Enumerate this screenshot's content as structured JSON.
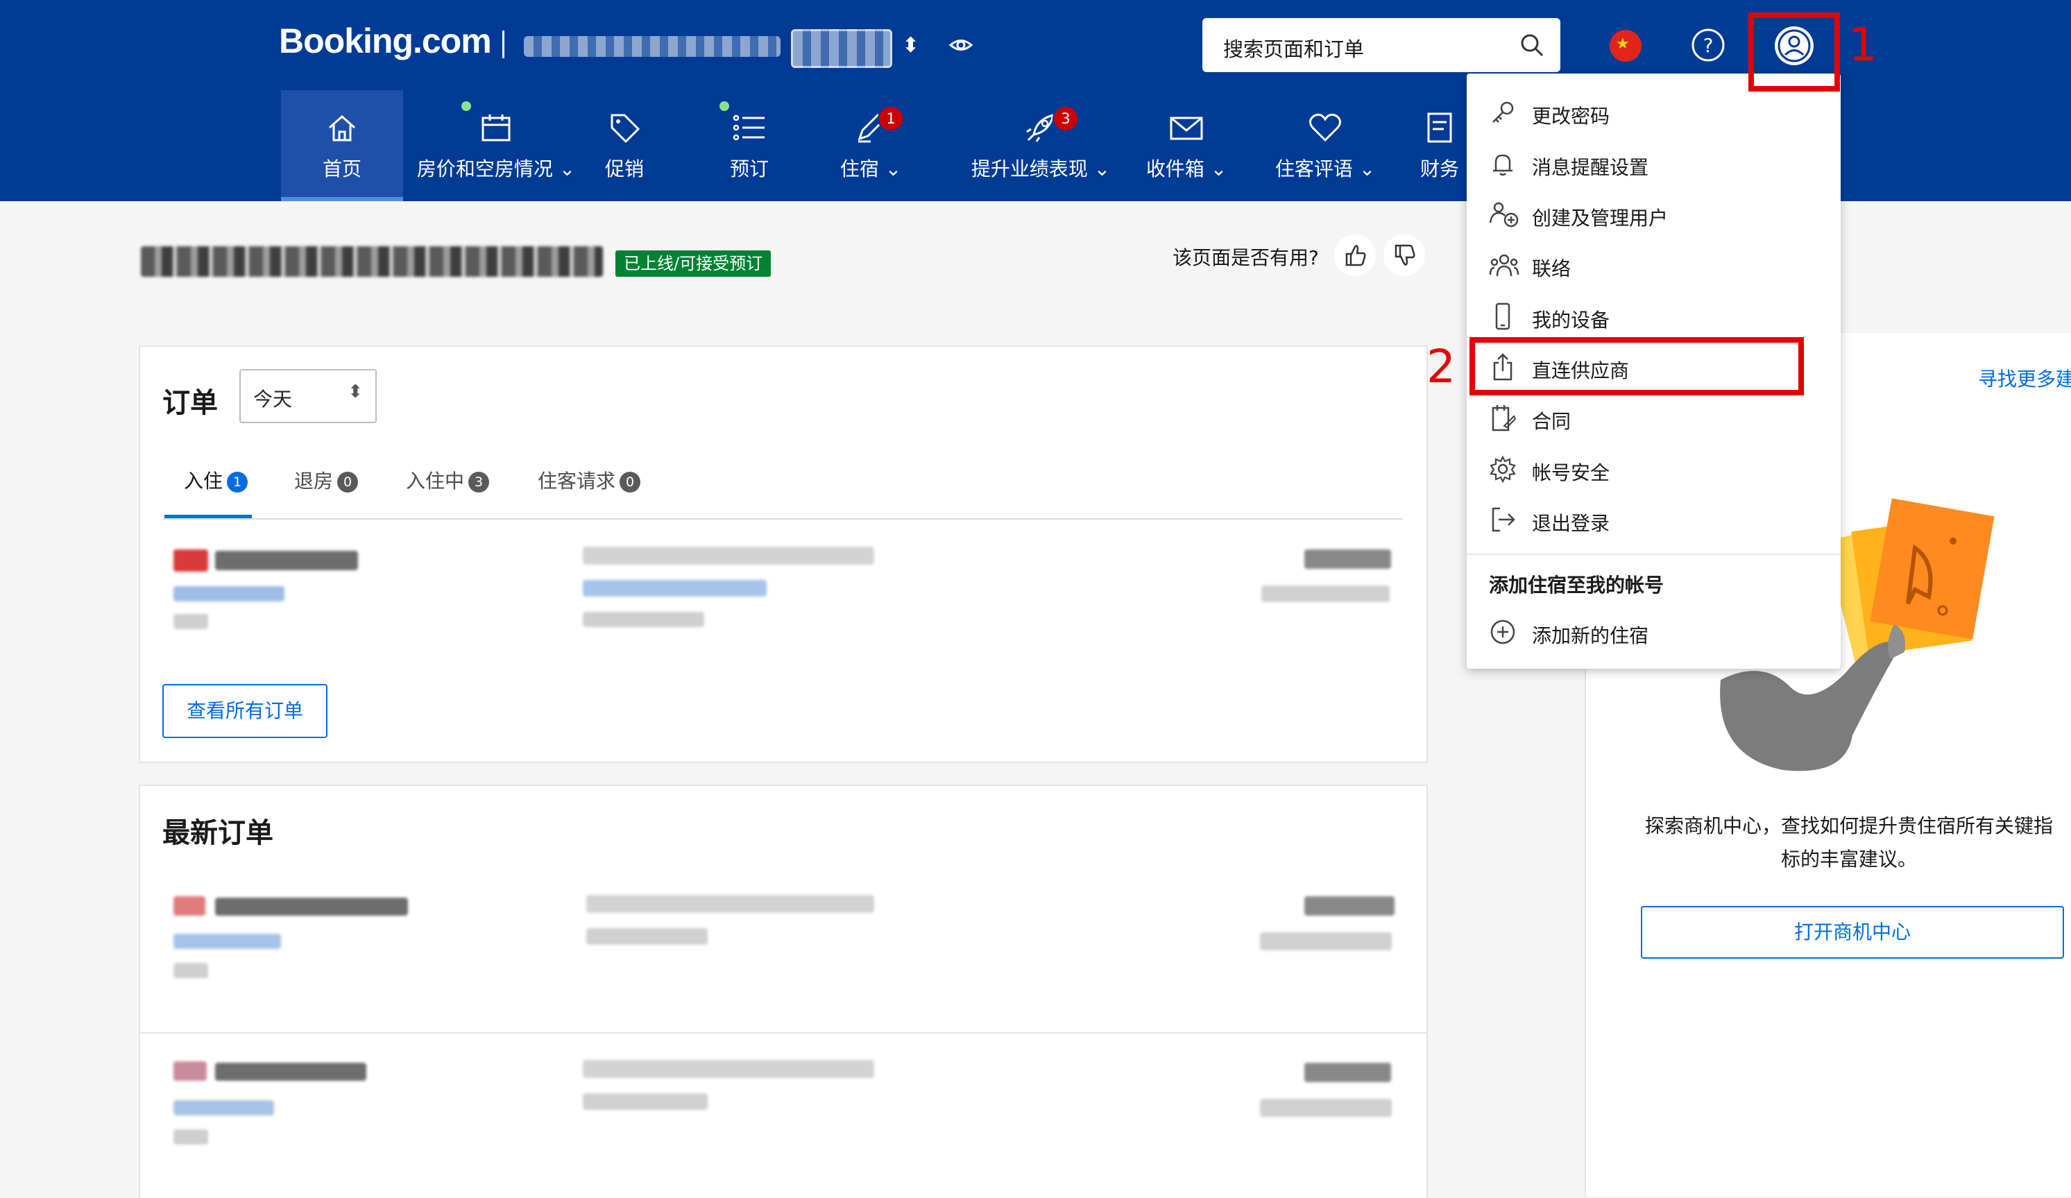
{
  "header": {
    "logo": "Booking.com",
    "search_placeholder": "搜索页面和订单",
    "nav": [
      {
        "label": "首页",
        "icon": "home-icon"
      },
      {
        "label": "房价和空房情况 ⌄",
        "icon": "calendar-icon"
      },
      {
        "label": "促销",
        "icon": "tag-icon"
      },
      {
        "label": "预订",
        "icon": "list-icon"
      },
      {
        "label": "住宿 ⌄",
        "icon": "pencil-icon",
        "badge": "1"
      },
      {
        "label": "提升业绩表现 ⌄",
        "icon": "rocket-icon",
        "badge": "3"
      },
      {
        "label": "收件箱 ⌄",
        "icon": "envelope-icon"
      },
      {
        "label": "住客评语 ⌄",
        "icon": "heart-icon"
      },
      {
        "label": "财务",
        "icon": "document-icon"
      }
    ]
  },
  "property": {
    "status": "已上线/可接受预订",
    "helpful_question": "该页面是否有用?"
  },
  "orders": {
    "title": "订单",
    "filter_value": "今天",
    "tabs": [
      {
        "label": "入住",
        "count": "1"
      },
      {
        "label": "退房",
        "count": "0"
      },
      {
        "label": "入住中",
        "count": "3"
      },
      {
        "label": "住客请求",
        "count": "0"
      }
    ],
    "view_all": "查看所有订单"
  },
  "latest": {
    "title": "最新订单"
  },
  "side": {
    "find_more": "寻找更多建",
    "text": "探索商机中心，查找如何提升贵住宿所有关键指标的丰富建议。",
    "button": "打开商机中心"
  },
  "menu": {
    "items": [
      {
        "label": "更改密码",
        "icon": "key-icon"
      },
      {
        "label": "消息提醒设置",
        "icon": "bell-icon"
      },
      {
        "label": "创建及管理用户",
        "icon": "add-user-icon"
      },
      {
        "label": "联络",
        "icon": "people-icon"
      },
      {
        "label": "我的设备",
        "icon": "phone-icon"
      },
      {
        "label": "直连供应商",
        "icon": "share-icon"
      },
      {
        "label": "合同",
        "icon": "contract-icon"
      },
      {
        "label": "帐号安全",
        "icon": "gear-icon"
      },
      {
        "label": "退出登录",
        "icon": "logout-icon"
      }
    ],
    "section_title": "添加住宿至我的帐号",
    "add_property": "添加新的住宿"
  },
  "annotations": {
    "label_1": "1",
    "label_2": "2"
  },
  "colors": {
    "brand_blue": "#003b95",
    "link_blue": "#006ce4",
    "status_green": "#008234",
    "annotation_red": "#e50000"
  }
}
